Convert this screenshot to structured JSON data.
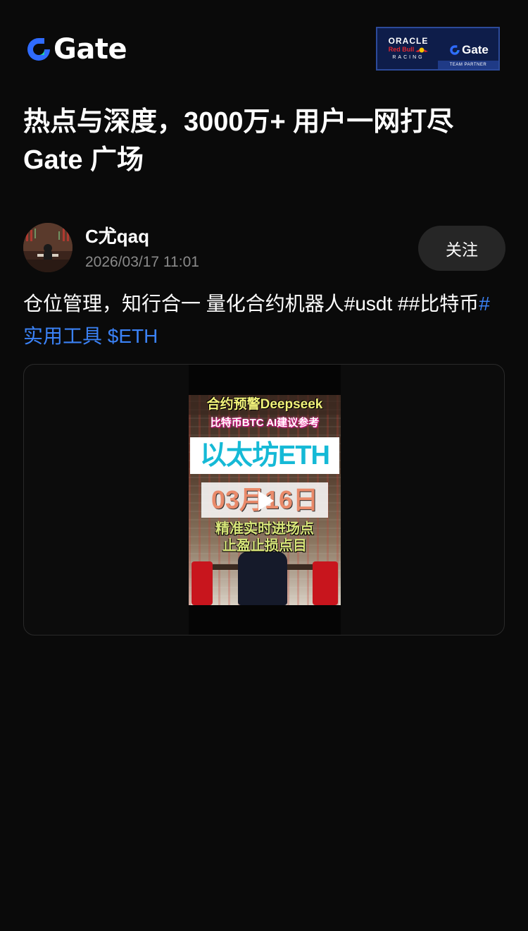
{
  "header": {
    "logo_text": "Gate",
    "partner": {
      "oracle": "ORACLE",
      "redbull": "Red Bull",
      "racing": "RACING",
      "gate": "Gate",
      "team_partner": "TEAM PARTNER"
    }
  },
  "headline": {
    "line1": "热点与深度，3000万+ 用户一网打尽",
    "line2": "Gate 广场"
  },
  "post": {
    "author": {
      "name": "C尤qaq",
      "avatar_icon": "avatar-image"
    },
    "timestamp": "2026/03/17 11:01",
    "follow_label": "关注",
    "text_plain": "仓位管理，知行合一 量化合约机器人#usdt ##比特币",
    "tags": [
      "#实用工具",
      "$ETH"
    ],
    "video_thumbnail": {
      "line1": "合约预警Deepseek",
      "line2": "比特币BTC AI建议参考",
      "line3": "以太坊ETH",
      "line4": "03月16日",
      "line5": "精准实时进场点",
      "line6": "止盈止损点目",
      "play_icon": "play-icon"
    }
  },
  "colors": {
    "background": "#0a0a0a",
    "accent_blue": "#3b82f6",
    "follow_bg": "#262626",
    "muted_text": "#8a8a8a"
  }
}
